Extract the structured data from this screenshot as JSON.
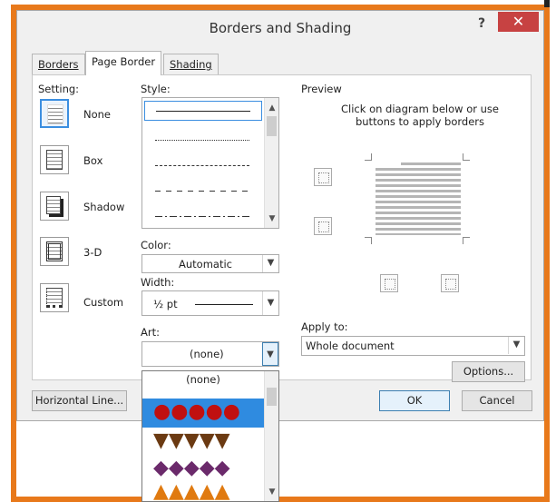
{
  "window": {
    "title": "Borders and Shading",
    "help_glyph": "?",
    "close_glyph": "✕"
  },
  "tabs": [
    {
      "label": "Borders",
      "active": false
    },
    {
      "label": "Page Border",
      "active": true
    },
    {
      "label": "Shading",
      "active": false
    }
  ],
  "setting": {
    "heading": "Setting:",
    "items": [
      {
        "label": "None",
        "icon": "setting-none-icon",
        "selected": true
      },
      {
        "label": "Box",
        "icon": "setting-box-icon",
        "selected": false
      },
      {
        "label": "Shadow",
        "icon": "setting-shadow-icon",
        "selected": false
      },
      {
        "label": "3-D",
        "icon": "setting-3d-icon",
        "selected": false
      },
      {
        "label": "Custom",
        "icon": "setting-custom-icon",
        "selected": false
      }
    ]
  },
  "style": {
    "heading": "Style:",
    "line_styles": [
      "solid",
      "dotted",
      "dashed",
      "long-dash",
      "dash-dot"
    ]
  },
  "color": {
    "heading": "Color:",
    "value": "Automatic"
  },
  "width": {
    "heading": "Width:",
    "value": "½ pt"
  },
  "art": {
    "heading": "Art:",
    "value": "(none)",
    "options_first": "(none)"
  },
  "preview": {
    "heading": "Preview",
    "instruction": "Click on diagram below or use buttons to apply borders"
  },
  "apply_to": {
    "heading": "Apply to:",
    "value": "Whole document"
  },
  "buttons": {
    "options": "Options...",
    "horizontal_line": "Horizontal Line...",
    "ok": "OK",
    "cancel": "Cancel"
  },
  "colors": {
    "accent_orange": "#e8791b",
    "close_red": "#c74242",
    "selection_blue": "#2f8be0"
  }
}
